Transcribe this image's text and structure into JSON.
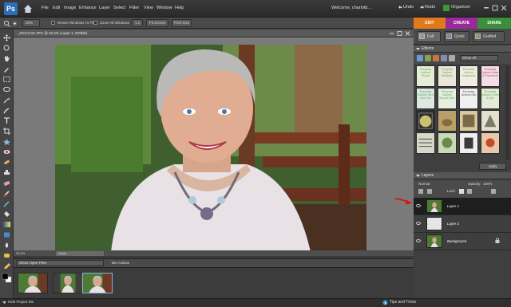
{
  "menubar": {
    "logo": "Ps",
    "items": [
      "File",
      "Edit",
      "Image",
      "Enhance",
      "Layer",
      "Select",
      "Filter",
      "View",
      "Window",
      "Help"
    ],
    "welcome": "Welcome, charlotti...",
    "undo": "Undo",
    "redo": "Redo",
    "organizer": "Organizer"
  },
  "options": {
    "zoom": "20%",
    "resize_windows": "Resize Windows To Fit",
    "zoom_all": "Zoom All Windows",
    "one_to_one": "1:1",
    "fit_screen": "Fit Screen",
    "print_size": "Print Size"
  },
  "mode_tabs": {
    "edit": "EDIT",
    "create": "CREATE",
    "share": "SHARE",
    "full": "Full",
    "quick": "Quick",
    "guided": "Guided"
  },
  "document": {
    "title": "_DSC1722.JPG @ 20.4% (Layer 1, RGB/8)",
    "zoom_value": "20.4%",
    "status_label": "Zoom"
  },
  "effects": {
    "title": "Effects",
    "show": "Show All",
    "apply": "Apply",
    "cells": [
      {
        "label": "Everyday Actions Florida",
        "bg": "#e7ecd6"
      },
      {
        "label": "Everyday Actions Heathery",
        "bg": "#eae6d8"
      },
      {
        "label": "Everyday Actions Hollywood",
        "bg": "#f1ece0"
      },
      {
        "label": "Everyday Actions Make A Thumbnail",
        "bg": "#f4dde4"
      },
      {
        "label": "Everyday Actions New York City",
        "bg": "#dde8e2"
      },
      {
        "label": "Everyday Actions Smooth Skin",
        "bg": "#e6eee0"
      },
      {
        "label": "Everyday Actions Stix",
        "bg": "#f0f0f0"
      },
      {
        "label": "Everyday Actions Youth & Eye",
        "bg": "#e4ecd8"
      }
    ]
  },
  "layers": {
    "title": "Layers",
    "blend_mode": "Normal",
    "opacity_label": "Opacity:",
    "opacity": "100%",
    "lock_label": "Lock:",
    "items": [
      {
        "name": "Layer 1"
      },
      {
        "name": "Layer 2"
      },
      {
        "name": "Background"
      }
    ]
  },
  "bin": {
    "show": "Show Open Files",
    "actions": "Bin Actions",
    "hide_label": "Hide Project Bin"
  },
  "tips": "Tips and Tricks"
}
